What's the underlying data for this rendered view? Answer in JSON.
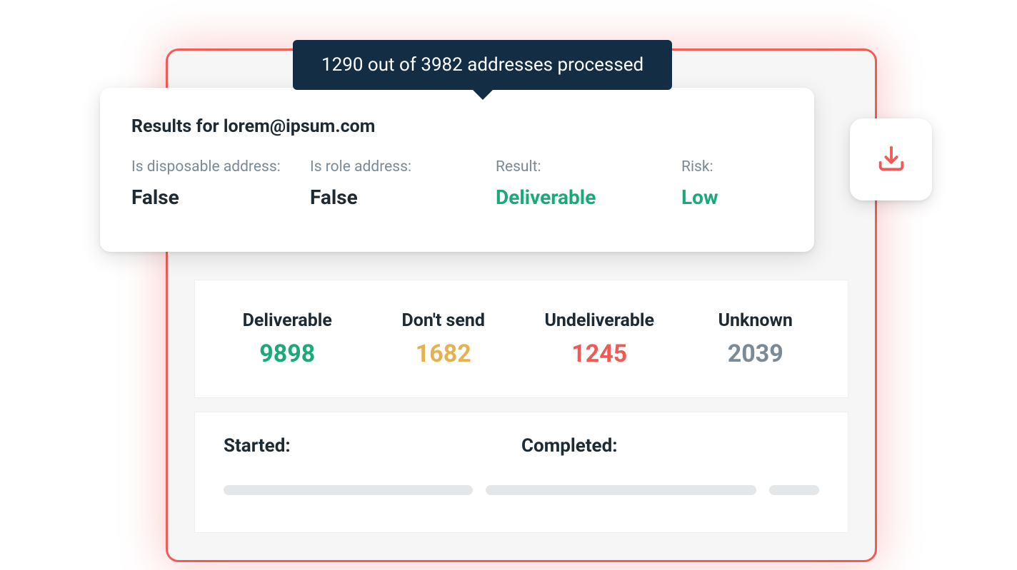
{
  "tooltip": {
    "text": "1290 out of 3982 addresses processed"
  },
  "result": {
    "title": "Results for lorem@ipsum.com",
    "fields": {
      "disposable_label": "Is disposable address:",
      "disposable_value": "False",
      "role_label": "Is role address:",
      "role_value": "False",
      "result_label": "Result:",
      "result_value": "Deliverable",
      "risk_label": "Risk:",
      "risk_value": "Low"
    }
  },
  "stats": {
    "deliverable_label": "Deliverable",
    "deliverable_value": "9898",
    "dont_send_label": "Don't send",
    "dont_send_value": "1682",
    "undeliverable_label": "Undeliverable",
    "undeliverable_value": "1245",
    "unknown_label": "Unknown",
    "unknown_value": "2039"
  },
  "timestamps": {
    "started_label": "Started:",
    "completed_label": "Completed:"
  },
  "icons": {
    "download": "download-icon"
  },
  "colors": {
    "accent_red": "#f15b55",
    "green": "#1aa97b",
    "amber": "#e6b24f",
    "gray": "#7a8a97",
    "tooltip_bg": "#132d44"
  }
}
